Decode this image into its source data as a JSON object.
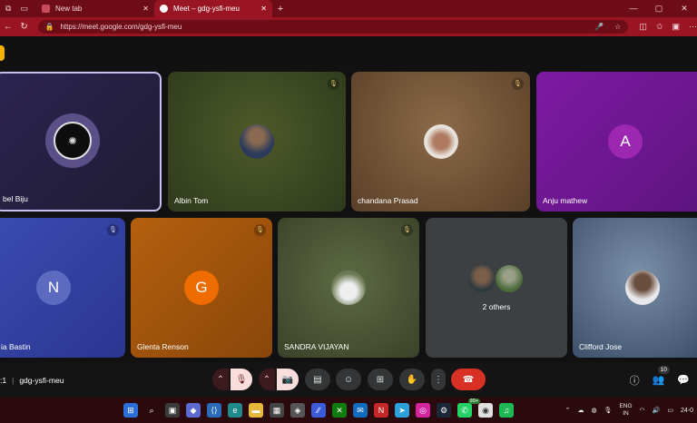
{
  "browser": {
    "tabs": [
      {
        "label": "New tab",
        "active": false
      },
      {
        "label": "Meet – gdg-ysfi-meu",
        "active": true
      }
    ],
    "new_tab_symbol": "+",
    "url": "https://meet.google.com/gdg-ysfi-meu",
    "window_controls": [
      "—",
      "▢",
      "✕"
    ]
  },
  "meet": {
    "meeting_code": "gdg-ysfi-meu",
    "clock_fragment": ":1",
    "participants_count": "10",
    "tiles": [
      {
        "name": "bel Biju",
        "type": "logo",
        "bg": "#2a2346",
        "highlighted": true
      },
      {
        "name": "Albin Tom",
        "type": "photo",
        "bg": "#3a4a22",
        "mic": "muted"
      },
      {
        "name": "chandana Prasad",
        "type": "photo",
        "bg": "#6e5236",
        "mic": "muted"
      },
      {
        "name": "Anju mathew",
        "type": "letter",
        "letter": "A",
        "bg": "#7b1aa0",
        "avatar_color": "#8e24aa"
      },
      {
        "name": "ia Bastin",
        "type": "letter",
        "letter": "N",
        "bg": "#3a4aa8",
        "avatar_color": "#5c6bc0",
        "mic": "muted"
      },
      {
        "name": "Glenta Renson",
        "type": "letter",
        "letter": "G",
        "bg": "#a85a10",
        "avatar_color": "#ef6c00",
        "mic": "muted"
      },
      {
        "name": "SANDRA VIJAYAN",
        "type": "photo",
        "bg": "#4a5536",
        "mic": "muted"
      },
      {
        "name": "2 others",
        "type": "others",
        "bg": "#3c4043"
      },
      {
        "name": "Clifford Jose",
        "type": "photo",
        "bg": "#4d6380"
      }
    ]
  },
  "taskbar": {
    "lang_line1": "ENG",
    "lang_line2": "IN",
    "date_fragment": "24-0",
    "notification_badge": "99+"
  }
}
